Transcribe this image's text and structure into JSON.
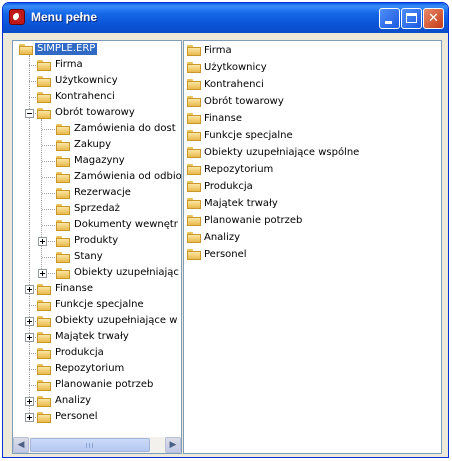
{
  "window": {
    "title": "Menu pełne",
    "buttons": {
      "minimize_glyph": "_",
      "maximize_glyph": "□",
      "close_glyph": "✕"
    }
  },
  "tree": {
    "root": {
      "label": "SIMPLE.ERP",
      "selected": true
    },
    "nodes": [
      {
        "label": "Firma",
        "expander": "none"
      },
      {
        "label": "Użytkownicy",
        "expander": "none"
      },
      {
        "label": "Kontrahenci",
        "expander": "none"
      },
      {
        "label": "Obrót towarowy",
        "expander": "minus",
        "children": [
          {
            "label": "Zamówienia do dost",
            "expander": "none"
          },
          {
            "label": "Zakupy",
            "expander": "none"
          },
          {
            "label": "Magazyny",
            "expander": "none"
          },
          {
            "label": "Zamówienia od odbio",
            "expander": "none"
          },
          {
            "label": "Rezerwacje",
            "expander": "none"
          },
          {
            "label": "Sprzedaż",
            "expander": "none"
          },
          {
            "label": "Dokumenty wewnętr",
            "expander": "none"
          },
          {
            "label": "Produkty",
            "expander": "plus"
          },
          {
            "label": "Stany",
            "expander": "none"
          },
          {
            "label": "Obiekty uzupełniając",
            "expander": "plus"
          }
        ]
      },
      {
        "label": "Finanse",
        "expander": "plus"
      },
      {
        "label": "Funkcje specjalne",
        "expander": "none"
      },
      {
        "label": "Obiekty uzupełniające w",
        "expander": "plus"
      },
      {
        "label": "Majątek trwały",
        "expander": "plus"
      },
      {
        "label": "Produkcja",
        "expander": "none"
      },
      {
        "label": "Repozytorium",
        "expander": "none"
      },
      {
        "label": "Planowanie potrzeb",
        "expander": "none"
      },
      {
        "label": "Analizy",
        "expander": "plus"
      },
      {
        "label": "Personel",
        "expander": "plus"
      }
    ],
    "scrollbar": {
      "left_arrow": "◀",
      "right_arrow": "▶"
    }
  },
  "list": {
    "items": [
      "Firma",
      "Użytkownicy",
      "Kontrahenci",
      "Obrót towarowy",
      "Finanse",
      "Funkcje specjalne",
      "Obiekty uzupełniające wspólne",
      "Repozytorium",
      "Produkcja",
      "Majątek trwały",
      "Planowanie potrzeb",
      "Analizy",
      "Personel"
    ]
  },
  "colors": {
    "titlebar": "#0b55d9",
    "selection": "#316ac5",
    "folder": "#e9b94d"
  }
}
